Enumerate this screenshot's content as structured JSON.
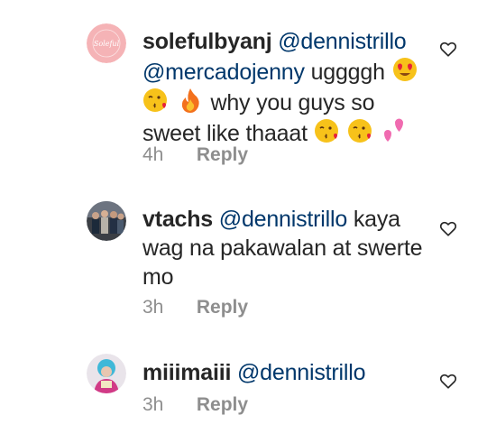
{
  "comments": [
    {
      "username": "solefulbyanj",
      "mention1": "@dennistrillo",
      "mention2": "@mercadojenny",
      "text1": "uggggh",
      "emojis1": [
        "heart-eyes-emoji",
        "kissing-heart-emoji",
        "fire-emoji"
      ],
      "text2": "why you guys so sweet like thaaat",
      "emojis2": [
        "kissing-heart-emoji",
        "kissing-heart-emoji",
        "two-hearts-emoji"
      ],
      "time": "4h",
      "reply_label": "Reply",
      "avatar_icon": "soleful-logo-avatar",
      "avatar_logo_text": "Soleful"
    },
    {
      "username": "vtachs",
      "mention1": "@dennistrillo",
      "text1": "kaya wag na pakawalan at swerte mo",
      "time": "3h",
      "reply_label": "Reply",
      "avatar_icon": "group-photo-avatar"
    },
    {
      "username": "miiimaiii",
      "mention1": "@dennistrillo",
      "time": "3h",
      "reply_label": "Reply",
      "avatar_icon": "person-photo-avatar"
    }
  ],
  "icons": {
    "like": "heart-outline-icon"
  },
  "colors": {
    "text": "#262626",
    "mention": "#00376b",
    "secondary": "#8e8e8e"
  }
}
